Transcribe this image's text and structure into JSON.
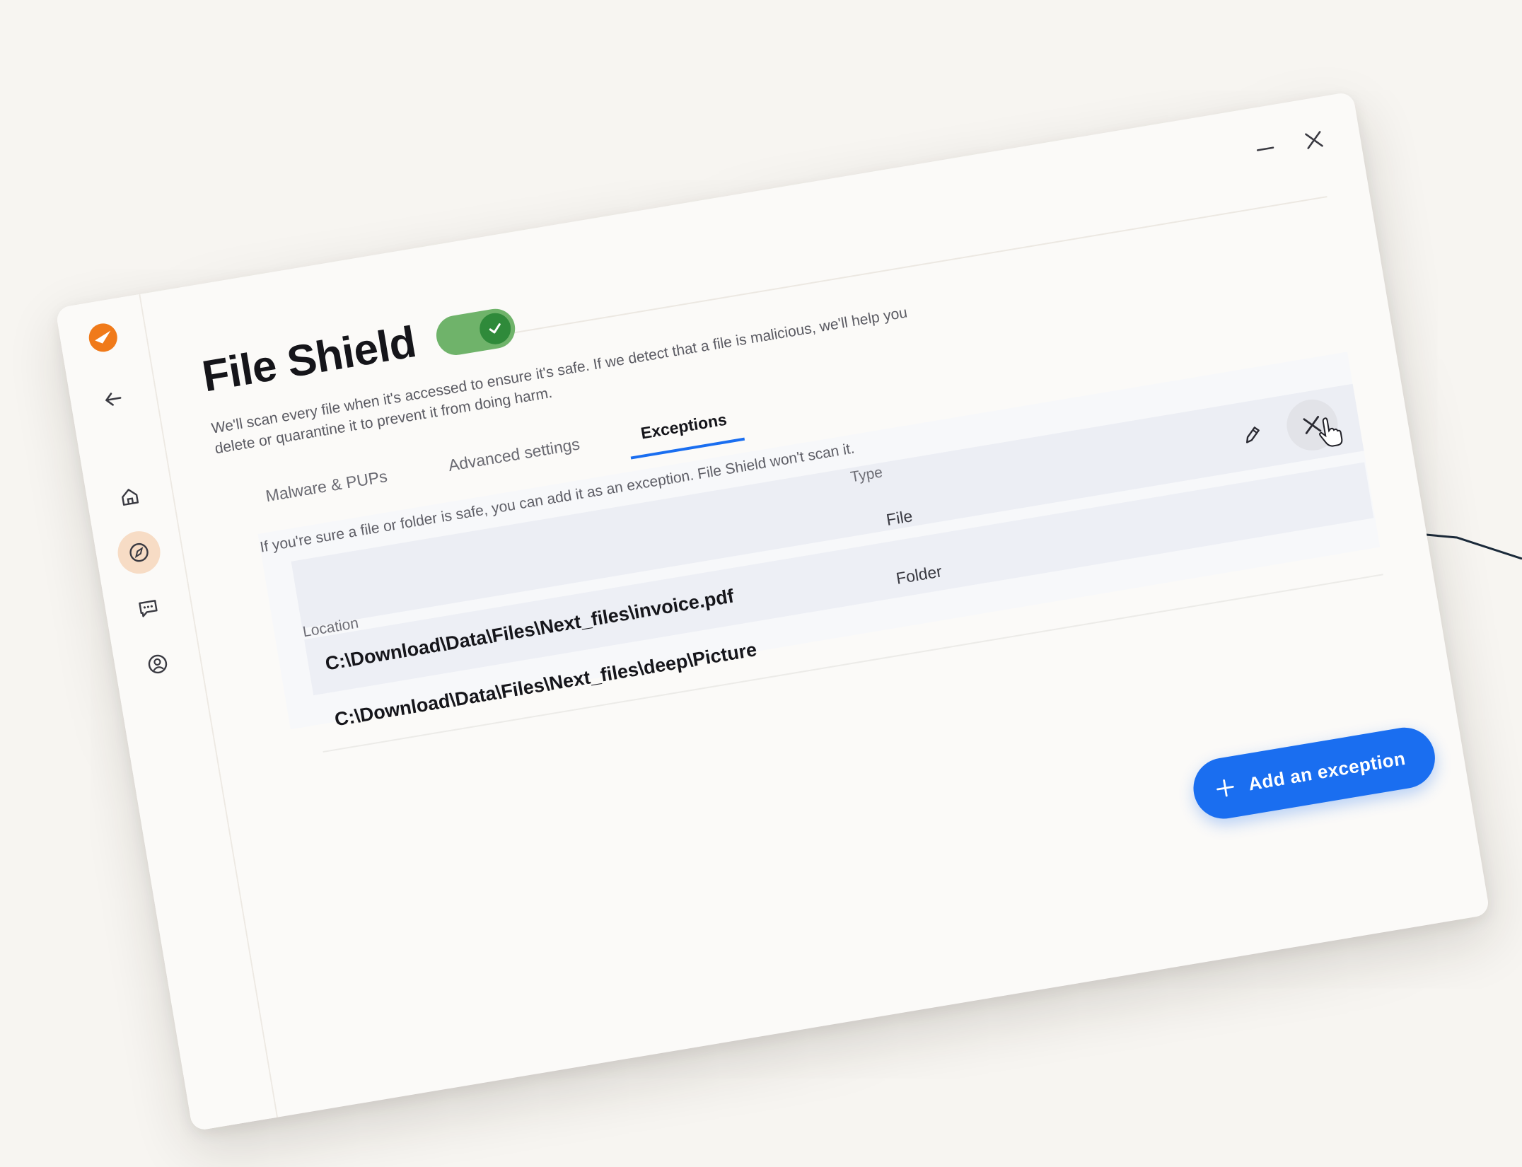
{
  "app": {
    "title": "File Shield",
    "description": "We'll scan every file when it's accessed to ensure it's safe. If we detect that a file is malicious, we'll help you delete or quarantine it to prevent it from doing harm.",
    "toggle": {
      "state": "on",
      "color": "#6fb36a"
    }
  },
  "tabs": [
    {
      "label": "Malware & PUPs",
      "active": false
    },
    {
      "label": "Advanced settings",
      "active": false
    },
    {
      "label": "Exceptions",
      "active": true
    }
  ],
  "exceptions": {
    "intro": "If you're sure a file or folder is safe, you can add it as an exception. File Shield won't scan it.",
    "columns": {
      "location": "Location",
      "type": "Type"
    },
    "rows": [
      {
        "location": "C:\\Download\\Data\\Files\\Next_files\\invoice.pdf",
        "type": "File"
      },
      {
        "location": "C:\\Download\\Data\\Files\\Next_files\\deep\\Picture",
        "type": "Folder"
      }
    ]
  },
  "actions": {
    "add_label": "Add an exception"
  },
  "sidebar": {
    "icons": [
      "logo-icon",
      "back-arrow-icon",
      "home-icon",
      "compass-icon",
      "chat-icon",
      "account-icon"
    ],
    "active": "compass-icon"
  },
  "colors": {
    "accent": "#1a6ef0",
    "brand": "#f07a1a",
    "active_nav": "#f7dcc5",
    "toggle_on": "#6fb36a"
  }
}
